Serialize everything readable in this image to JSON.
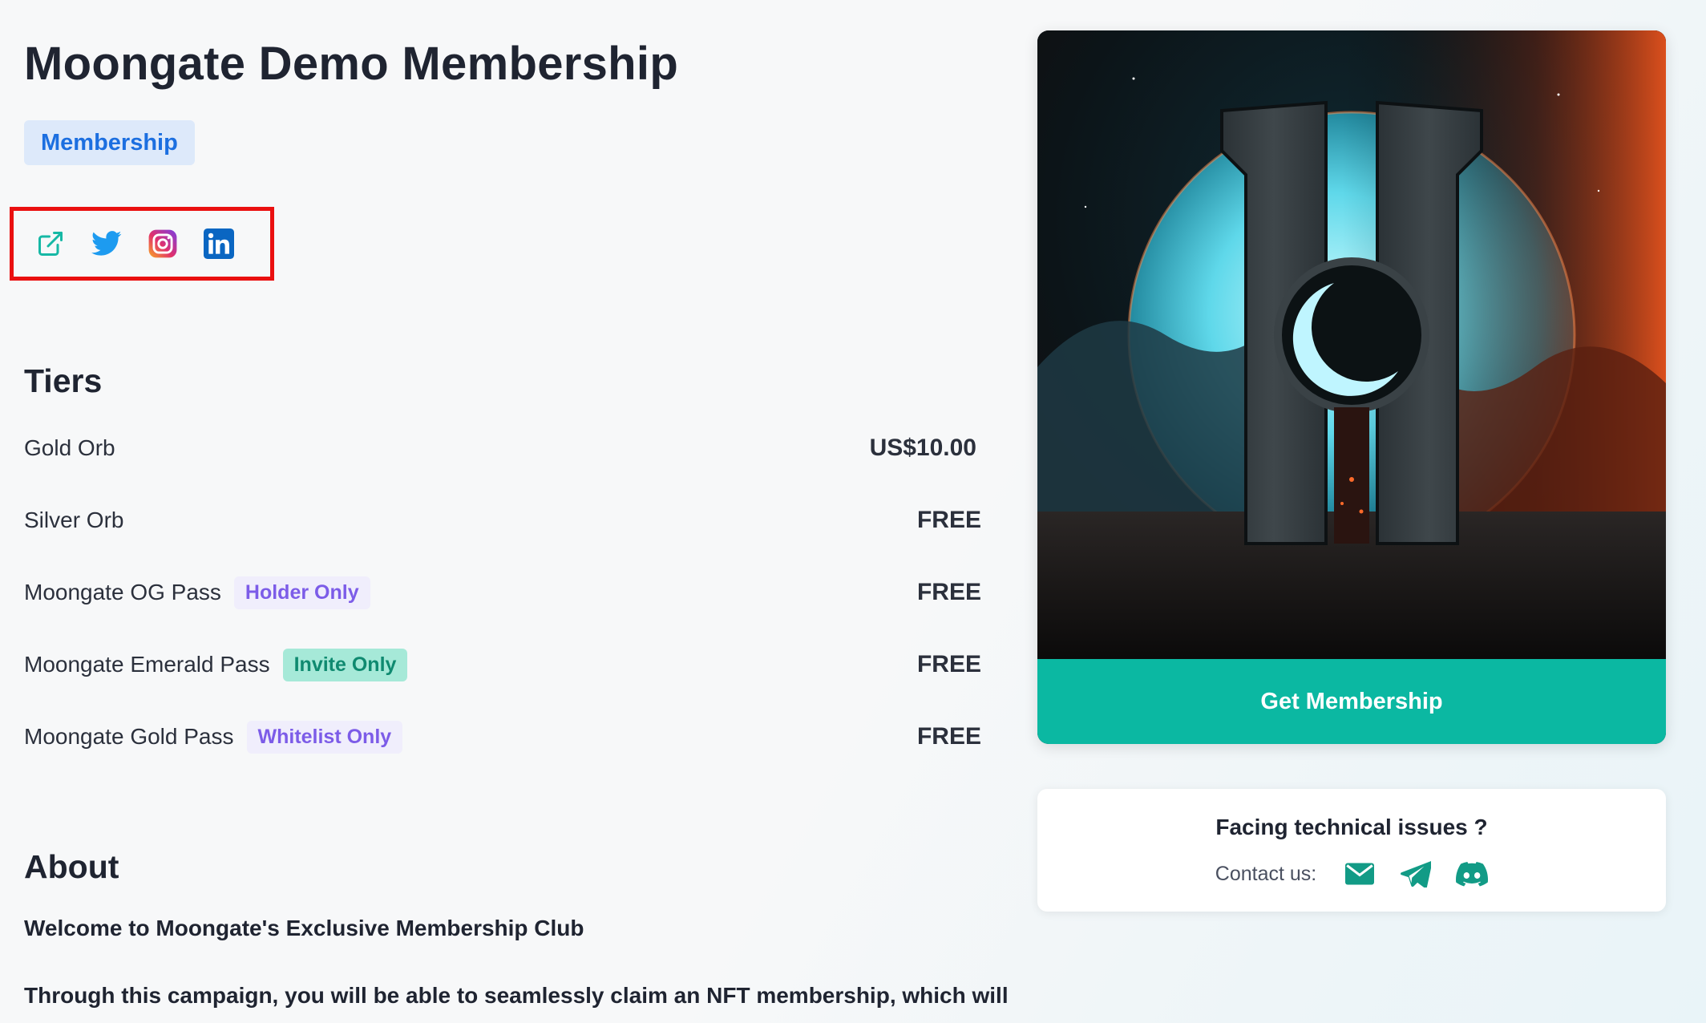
{
  "page": {
    "title": "Moongate Demo Membership",
    "category": "Membership"
  },
  "social_icons": [
    "external-link-icon",
    "twitter-icon",
    "instagram-icon",
    "linkedin-icon"
  ],
  "tiers": {
    "heading": "Tiers",
    "items": [
      {
        "name": "Gold Orb",
        "tag": "",
        "price": "US$10.00"
      },
      {
        "name": "Silver Orb",
        "tag": "",
        "price": "FREE"
      },
      {
        "name": "Moongate OG Pass",
        "tag": "Holder Only",
        "price": "FREE"
      },
      {
        "name": "Moongate Emerald Pass",
        "tag": "Invite Only",
        "price": "FREE"
      },
      {
        "name": "Moongate Gold Pass",
        "tag": "Whitelist Only",
        "price": "FREE"
      }
    ]
  },
  "about": {
    "heading": "About",
    "lead": "Welcome to Moongate's Exclusive Membership Club",
    "body": "Through this campaign, you will be able to seamlessly claim an NFT membership, which will"
  },
  "card": {
    "cta_label": "Get Membership"
  },
  "support": {
    "title": "Facing technical issues ?",
    "contact_label": "Contact us:",
    "icons": [
      "mail-icon",
      "telegram-icon",
      "discord-icon"
    ]
  },
  "colors": {
    "accent": "#0bb8a2",
    "highlight_border": "#ea1010",
    "badge_bg": "#dde9fa",
    "badge_text": "#1c6fe0",
    "tag_purple": "#7c5ce8",
    "tag_green_bg": "#a6e9d8",
    "tag_green_text": "#0f8a70"
  }
}
